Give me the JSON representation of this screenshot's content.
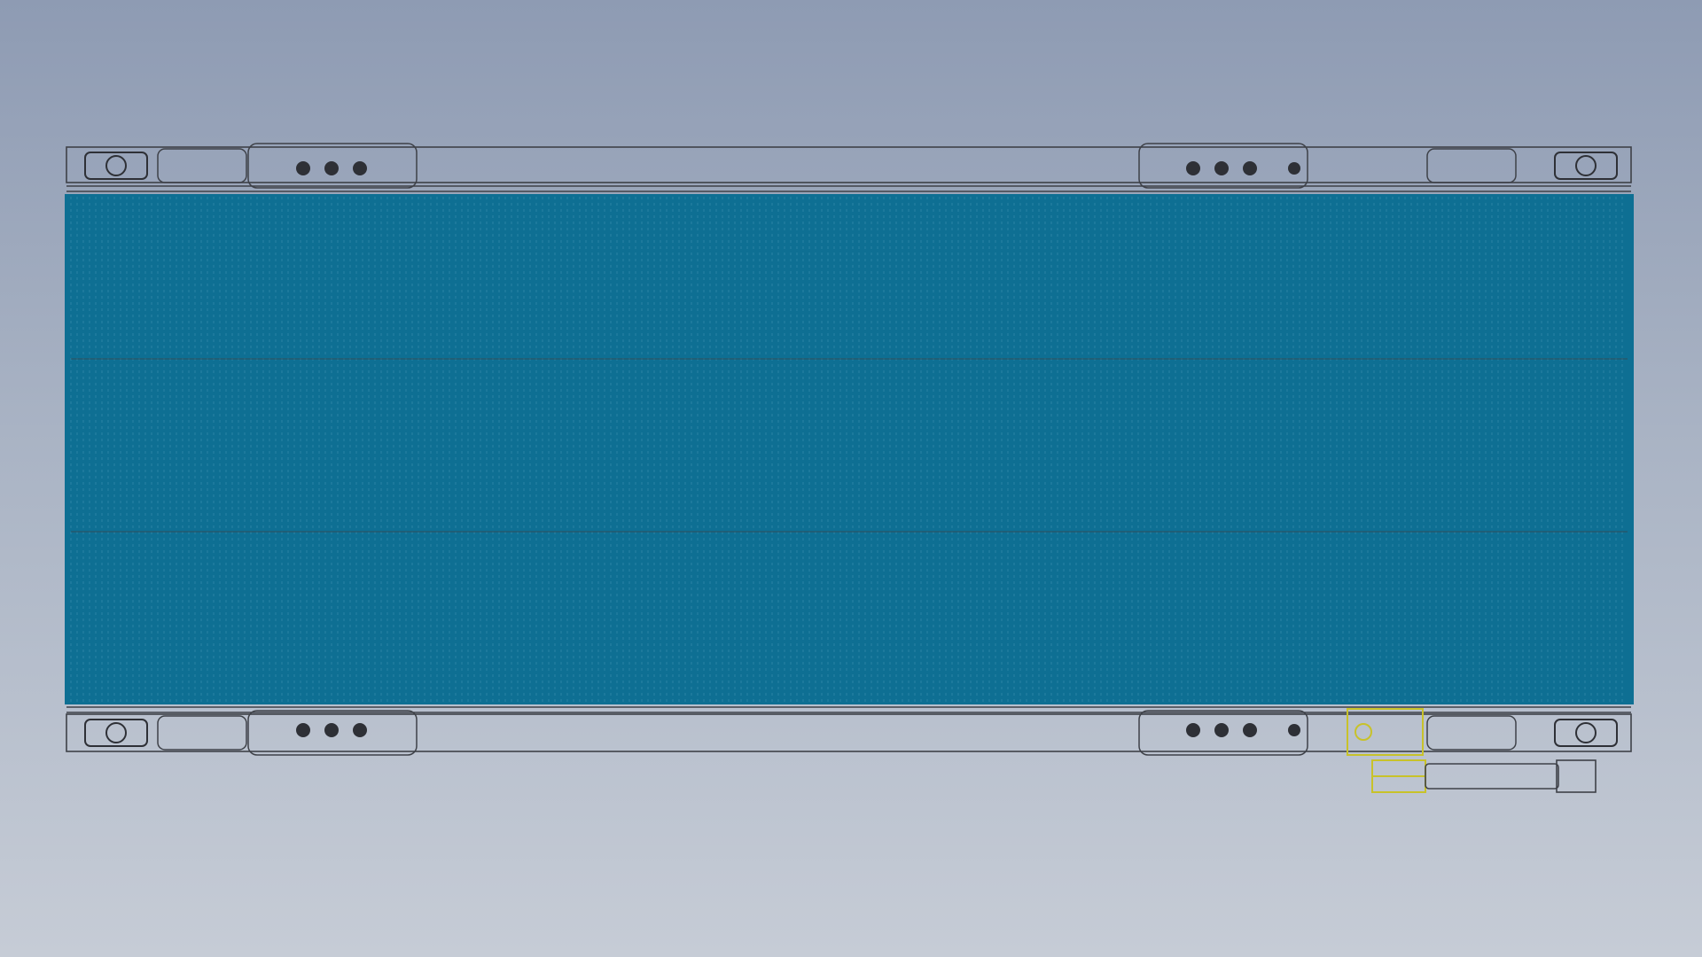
{
  "scene": {
    "view": "top",
    "model": "belt-conveyor-assembly",
    "colors": {
      "background_top": "#8e9bb3",
      "background_bottom": "#c6ccd6",
      "belt": "#0e6f93",
      "belt_line": "#8fd0e8",
      "frame_line": "#3e4148",
      "drive_unit": "#c8c22a"
    },
    "parts": {
      "belt": {
        "icon": "conveyor-belt"
      },
      "side_frames": {
        "count": 2
      },
      "end_bearings": {
        "count": 4
      },
      "mounting_brackets": {
        "count": 4
      },
      "drive_motor": {
        "color_role": "drive_unit"
      }
    }
  }
}
